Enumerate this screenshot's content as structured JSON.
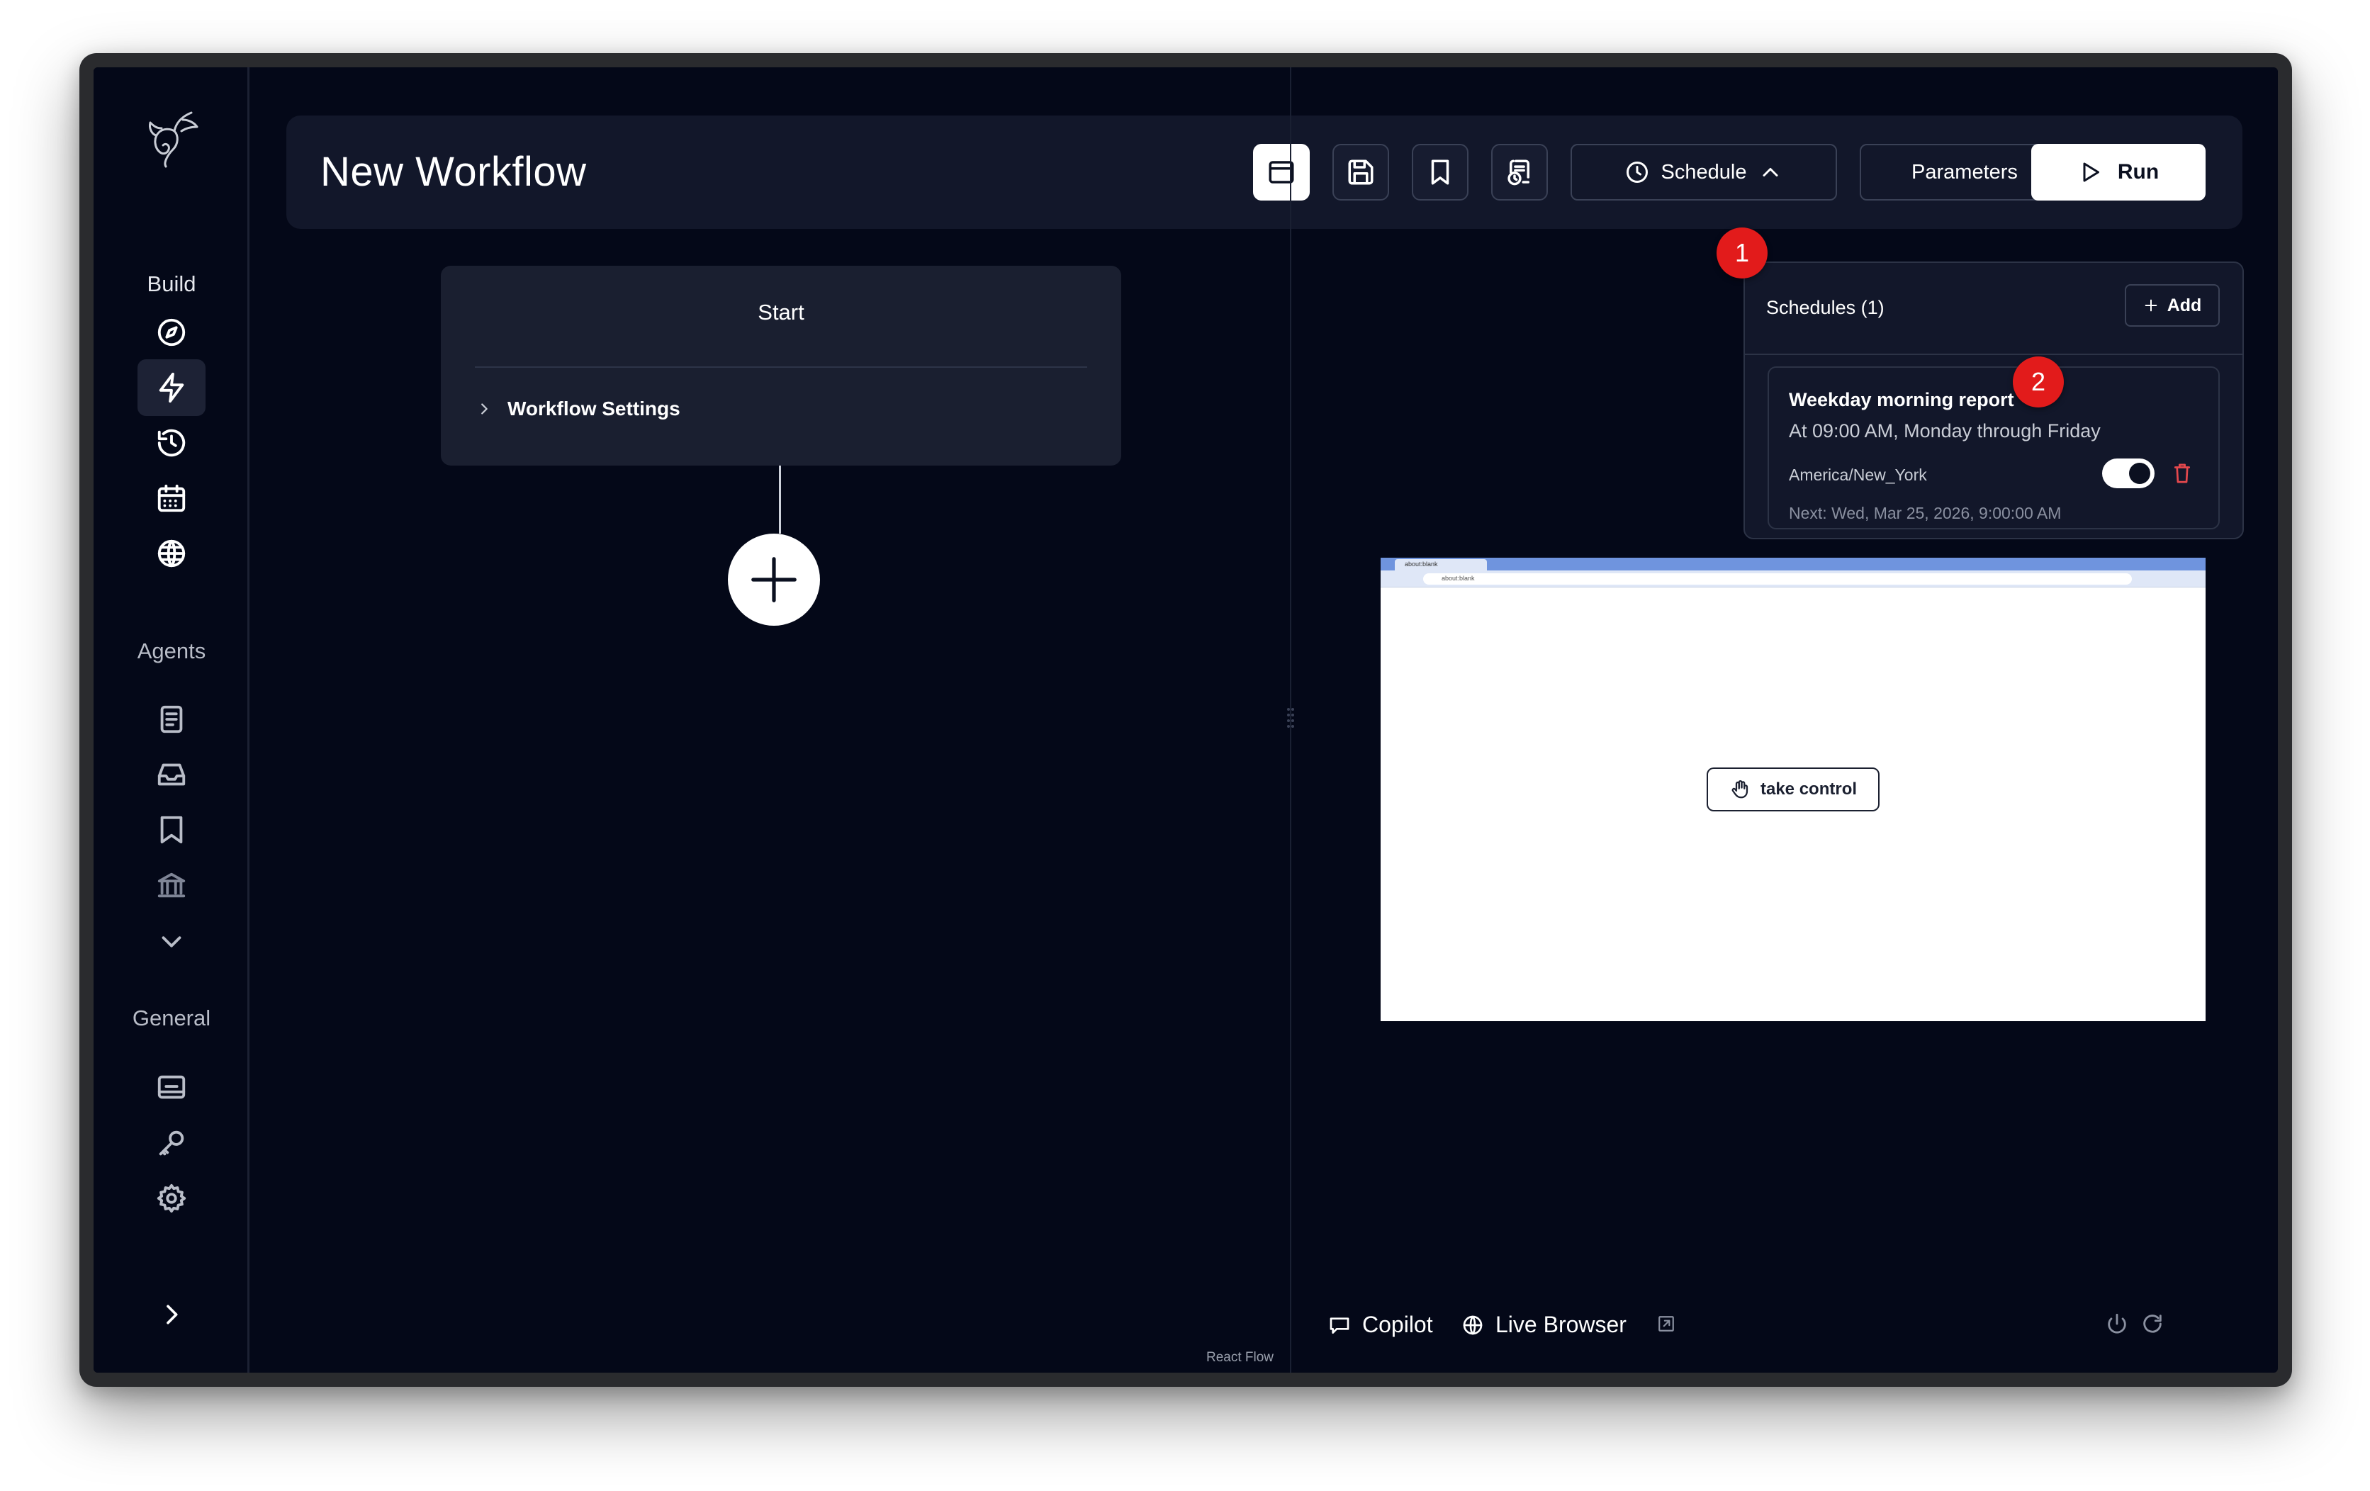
{
  "sidebar": {
    "sections": {
      "build": "Build",
      "agents": "Agents",
      "general": "General"
    },
    "build_items": [
      "compass-icon",
      "zap-icon",
      "history-icon",
      "calendar-icon",
      "globe-icon"
    ],
    "agent_items": [
      "file-text-icon",
      "inbox-icon",
      "bookmark-icon",
      "bank-icon",
      "chevron-down-icon"
    ],
    "general_items": [
      "monitor-icon",
      "key-icon",
      "gear-icon"
    ],
    "active_item": "zap-icon"
  },
  "header": {
    "title": "New Workflow",
    "schedule_label": "Schedule",
    "parameters_label": "Parameters",
    "run_label": "Run"
  },
  "canvas": {
    "start_title": "Start",
    "workflow_settings_label": "Workflow Settings",
    "attribution": "React Flow"
  },
  "badges": {
    "first": "1",
    "second": "2"
  },
  "schedules": {
    "heading": "Schedules (1)",
    "add_label": "Add",
    "items": [
      {
        "name": "Weekday morning report",
        "description": "At 09:00 AM, Monday through Friday",
        "timezone": "America/New_York",
        "enabled": true,
        "next_run": "Next: Wed, Mar 25, 2026, 9:00:00 AM"
      }
    ]
  },
  "browser": {
    "tab_title": "about:blank",
    "url": "about:blank",
    "take_control_label": "take control"
  },
  "bottom_bar": {
    "copilot_label": "Copilot",
    "live_browser_label": "Live Browser"
  },
  "colors": {
    "background": "#040818",
    "panel": "#12172a",
    "badge": "#e21b1b",
    "delete": "#e5484d"
  }
}
